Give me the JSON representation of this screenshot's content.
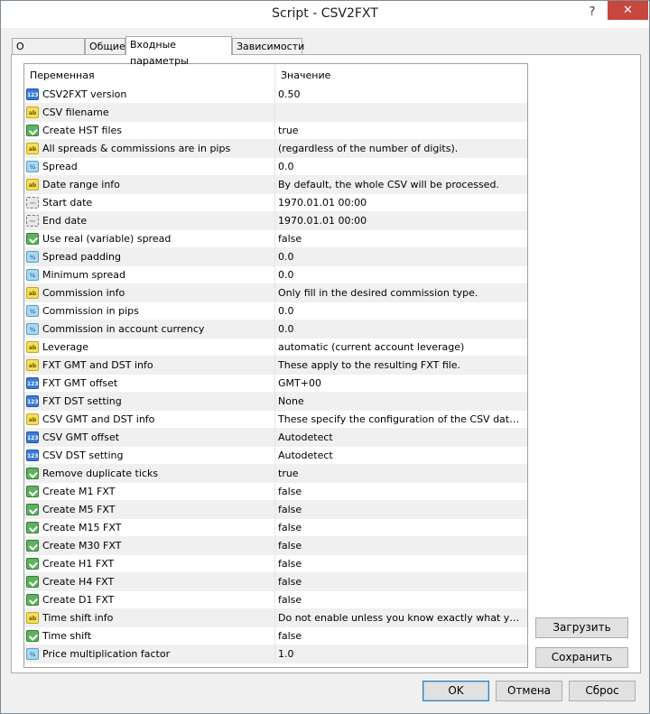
{
  "window": {
    "title": "Script - CSV2FXT",
    "help": "?",
    "close": "✕"
  },
  "tabs": [
    "О программе",
    "Общие",
    "Входные параметры",
    "Зависимости"
  ],
  "grid": {
    "col_name": "Переменная",
    "col_value": "Значение",
    "rows": [
      {
        "icon": "num",
        "name": "CSV2FXT version",
        "value": "0.50"
      },
      {
        "icon": "str",
        "name": "CSV filename",
        "value": ""
      },
      {
        "icon": "bool",
        "name": "Create HST files",
        "value": "true"
      },
      {
        "icon": "str",
        "name": "All spreads & commissions are in pips",
        "value": "(regardless of the number of digits)."
      },
      {
        "icon": "dbl",
        "name": "Spread",
        "value": "0.0"
      },
      {
        "icon": "str",
        "name": "Date range info",
        "value": "By default, the whole CSV will be processed."
      },
      {
        "icon": "dt",
        "name": "Start date",
        "value": "1970.01.01 00:00"
      },
      {
        "icon": "dt",
        "name": "End date",
        "value": "1970.01.01 00:00"
      },
      {
        "icon": "bool",
        "name": "Use real (variable) spread",
        "value": "false"
      },
      {
        "icon": "dbl",
        "name": "Spread padding",
        "value": "0.0"
      },
      {
        "icon": "dbl",
        "name": "Minimum spread",
        "value": "0.0"
      },
      {
        "icon": "str",
        "name": "Commission info",
        "value": "Only fill in the desired commission type."
      },
      {
        "icon": "dbl",
        "name": "Commission in pips",
        "value": "0.0"
      },
      {
        "icon": "dbl",
        "name": "Commission in account currency",
        "value": "0.0"
      },
      {
        "icon": "str",
        "name": "Leverage",
        "value": "automatic (current account leverage)"
      },
      {
        "icon": "str",
        "name": "FXT GMT and DST info",
        "value": "These apply to the resulting FXT file."
      },
      {
        "icon": "num",
        "name": "FXT GMT offset",
        "value": "GMT+00"
      },
      {
        "icon": "num",
        "name": "FXT DST setting",
        "value": "None"
      },
      {
        "icon": "str",
        "name": "CSV GMT and DST info",
        "value": "These specify the configuration of the CSV data file."
      },
      {
        "icon": "num",
        "name": "CSV GMT offset",
        "value": "Autodetect"
      },
      {
        "icon": "num",
        "name": "CSV DST setting",
        "value": "Autodetect"
      },
      {
        "icon": "bool",
        "name": "Remove duplicate ticks",
        "value": "true"
      },
      {
        "icon": "bool",
        "name": "Create M1 FXT",
        "value": "false"
      },
      {
        "icon": "bool",
        "name": "Create M5 FXT",
        "value": "false"
      },
      {
        "icon": "bool",
        "name": "Create M15 FXT",
        "value": "false"
      },
      {
        "icon": "bool",
        "name": "Create M30 FXT",
        "value": "false"
      },
      {
        "icon": "bool",
        "name": "Create H1 FXT",
        "value": "false"
      },
      {
        "icon": "bool",
        "name": "Create H4 FXT",
        "value": "false"
      },
      {
        "icon": "bool",
        "name": "Create D1 FXT",
        "value": "false"
      },
      {
        "icon": "str",
        "name": "Time shift info",
        "value": "Do not enable unless you know exactly what you're doi..."
      },
      {
        "icon": "bool",
        "name": "Time shift",
        "value": "false"
      },
      {
        "icon": "dbl",
        "name": "Price multiplication factor",
        "value": "1.0"
      }
    ]
  },
  "side_buttons": {
    "load": "Загрузить",
    "save": "Сохранить"
  },
  "footer_buttons": {
    "ok": "OK",
    "cancel": "Отмена",
    "reset": "Сброс"
  },
  "icon_glyphs": {
    "num": "123",
    "str": "ab",
    "bool": "",
    "dbl": "½",
    "dt": "⋯"
  }
}
